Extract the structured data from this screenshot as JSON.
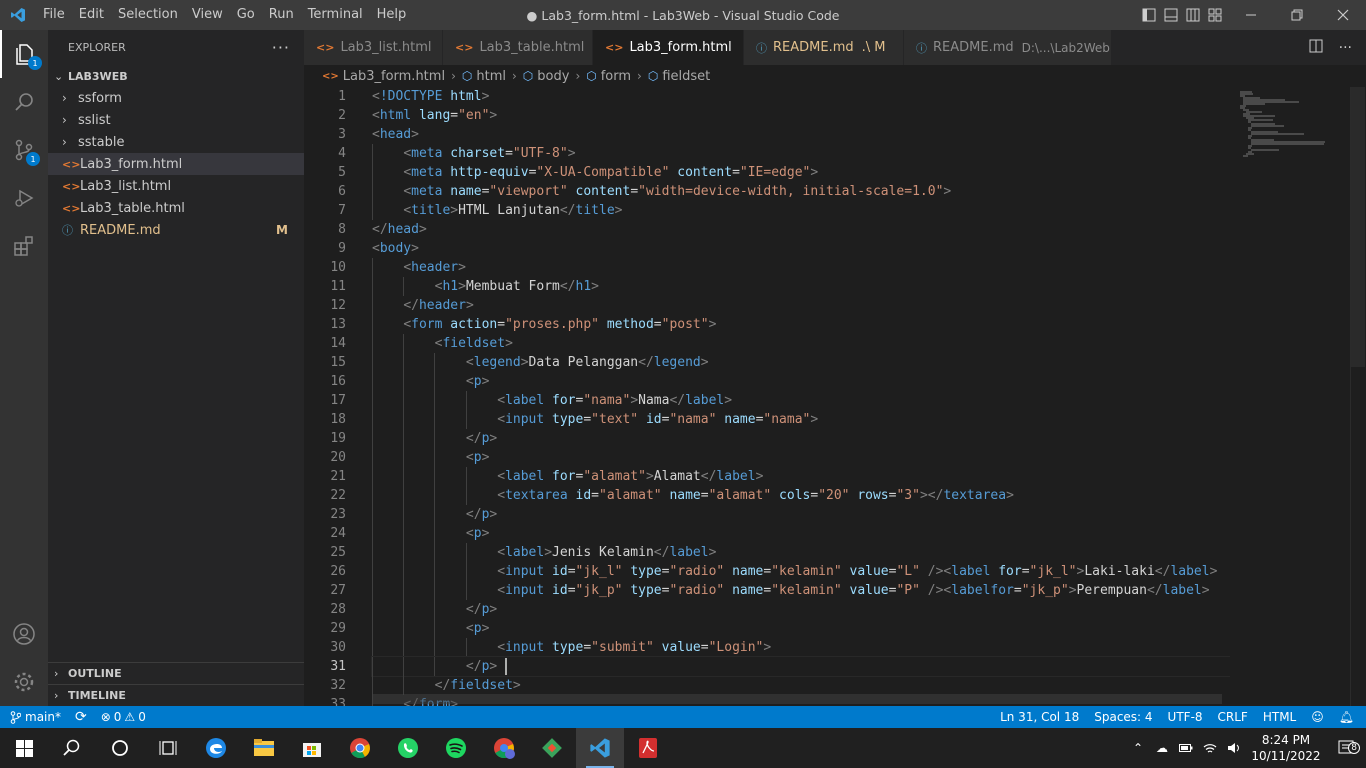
{
  "titlebar": {
    "menu": [
      "File",
      "Edit",
      "Selection",
      "View",
      "Go",
      "Run",
      "Terminal",
      "Help"
    ],
    "window_title": "● Lab3_form.html - Lab3Web - Visual Studio Code"
  },
  "activity": {
    "explorer_badge": "1",
    "scm_badge": "1"
  },
  "explorer": {
    "title": "EXPLORER",
    "more": "···",
    "project": "LAB3WEB",
    "folders": [
      "ssform",
      "sslist",
      "sstable"
    ],
    "files": [
      {
        "name": "Lab3_form.html",
        "icon": "<>",
        "selected": true
      },
      {
        "name": "Lab3_list.html",
        "icon": "<>"
      },
      {
        "name": "Lab3_table.html",
        "icon": "<>"
      },
      {
        "name": "README.md",
        "icon": "ⓘ",
        "status": "M"
      }
    ],
    "outline": "OUTLINE",
    "timeline": "TIMELINE"
  },
  "tabs": [
    {
      "label": "Lab3_list.html",
      "icon": "<>"
    },
    {
      "label": "Lab3_table.html",
      "icon": "<>"
    },
    {
      "label": "Lab3_form.html",
      "icon": "<>",
      "active": true,
      "dirty": true
    },
    {
      "label": "README.md",
      "icon": "ⓘ",
      "suffix": ".\\ M"
    },
    {
      "label": "README.md",
      "icon": "ⓘ",
      "desc": "D:\\...\\Lab2Web"
    }
  ],
  "breadcrumb": [
    "Lab3_form.html",
    "html",
    "body",
    "form",
    "fieldset"
  ],
  "code": {
    "current_line": 31,
    "lines": [
      [
        [
          "br",
          "<"
        ],
        [
          "tag",
          "!DOCTYPE"
        ],
        [
          "tx",
          " "
        ],
        [
          "at",
          "html"
        ],
        [
          "br",
          ">"
        ]
      ],
      [
        [
          "br",
          "<"
        ],
        [
          "tag",
          "html"
        ],
        [
          "tx",
          " "
        ],
        [
          "at",
          "lang"
        ],
        [
          "tx",
          "="
        ],
        [
          "st",
          "\"en\""
        ],
        [
          "br",
          ">"
        ]
      ],
      [
        [
          "br",
          "<"
        ],
        [
          "tag",
          "head"
        ],
        [
          "br",
          ">"
        ]
      ],
      [
        [
          "tx",
          "    "
        ],
        [
          "br",
          "<"
        ],
        [
          "tag",
          "meta"
        ],
        [
          "tx",
          " "
        ],
        [
          "at",
          "charset"
        ],
        [
          "tx",
          "="
        ],
        [
          "st",
          "\"UTF-8\""
        ],
        [
          "br",
          ">"
        ]
      ],
      [
        [
          "tx",
          "    "
        ],
        [
          "br",
          "<"
        ],
        [
          "tag",
          "meta"
        ],
        [
          "tx",
          " "
        ],
        [
          "at",
          "http-equiv"
        ],
        [
          "tx",
          "="
        ],
        [
          "st",
          "\"X-UA-Compatible\""
        ],
        [
          "tx",
          " "
        ],
        [
          "at",
          "content"
        ],
        [
          "tx",
          "="
        ],
        [
          "st",
          "\"IE=edge\""
        ],
        [
          "br",
          ">"
        ]
      ],
      [
        [
          "tx",
          "    "
        ],
        [
          "br",
          "<"
        ],
        [
          "tag",
          "meta"
        ],
        [
          "tx",
          " "
        ],
        [
          "at",
          "name"
        ],
        [
          "tx",
          "="
        ],
        [
          "st",
          "\"viewport\""
        ],
        [
          "tx",
          " "
        ],
        [
          "at",
          "content"
        ],
        [
          "tx",
          "="
        ],
        [
          "st",
          "\"width=device-width, initial-scale=1.0\""
        ],
        [
          "br",
          ">"
        ]
      ],
      [
        [
          "tx",
          "    "
        ],
        [
          "br",
          "<"
        ],
        [
          "tag",
          "title"
        ],
        [
          "br",
          ">"
        ],
        [
          "tx",
          "HTML Lanjutan"
        ],
        [
          "br",
          "</"
        ],
        [
          "tag",
          "title"
        ],
        [
          "br",
          ">"
        ]
      ],
      [
        [
          "br",
          "</"
        ],
        [
          "tag",
          "head"
        ],
        [
          "br",
          ">"
        ]
      ],
      [
        [
          "br",
          "<"
        ],
        [
          "tag",
          "body"
        ],
        [
          "br",
          ">"
        ]
      ],
      [
        [
          "tx",
          "    "
        ],
        [
          "br",
          "<"
        ],
        [
          "tag",
          "header"
        ],
        [
          "br",
          ">"
        ]
      ],
      [
        [
          "tx",
          "        "
        ],
        [
          "br",
          "<"
        ],
        [
          "tag",
          "h1"
        ],
        [
          "br",
          ">"
        ],
        [
          "tx",
          "Membuat Form"
        ],
        [
          "br",
          "</"
        ],
        [
          "tag",
          "h1"
        ],
        [
          "br",
          ">"
        ]
      ],
      [
        [
          "tx",
          "    "
        ],
        [
          "br",
          "</"
        ],
        [
          "tag",
          "header"
        ],
        [
          "br",
          ">"
        ]
      ],
      [
        [
          "tx",
          "    "
        ],
        [
          "br",
          "<"
        ],
        [
          "tag",
          "form"
        ],
        [
          "tx",
          " "
        ],
        [
          "at",
          "action"
        ],
        [
          "tx",
          "="
        ],
        [
          "st",
          "\"proses.php\""
        ],
        [
          "tx",
          " "
        ],
        [
          "at",
          "method"
        ],
        [
          "tx",
          "="
        ],
        [
          "st",
          "\"post\""
        ],
        [
          "br",
          ">"
        ]
      ],
      [
        [
          "tx",
          "        "
        ],
        [
          "br",
          "<"
        ],
        [
          "tag",
          "fieldset"
        ],
        [
          "br",
          ">"
        ]
      ],
      [
        [
          "tx",
          "            "
        ],
        [
          "br",
          "<"
        ],
        [
          "tag",
          "legend"
        ],
        [
          "br",
          ">"
        ],
        [
          "tx",
          "Data Pelanggan"
        ],
        [
          "br",
          "</"
        ],
        [
          "tag",
          "legend"
        ],
        [
          "br",
          ">"
        ]
      ],
      [
        [
          "tx",
          "            "
        ],
        [
          "br",
          "<"
        ],
        [
          "tag",
          "p"
        ],
        [
          "br",
          ">"
        ]
      ],
      [
        [
          "tx",
          "                "
        ],
        [
          "br",
          "<"
        ],
        [
          "tag",
          "label"
        ],
        [
          "tx",
          " "
        ],
        [
          "at",
          "for"
        ],
        [
          "tx",
          "="
        ],
        [
          "st",
          "\"nama\""
        ],
        [
          "br",
          ">"
        ],
        [
          "tx",
          "Nama"
        ],
        [
          "br",
          "</"
        ],
        [
          "tag",
          "label"
        ],
        [
          "br",
          ">"
        ]
      ],
      [
        [
          "tx",
          "                "
        ],
        [
          "br",
          "<"
        ],
        [
          "tag",
          "input"
        ],
        [
          "tx",
          " "
        ],
        [
          "at",
          "type"
        ],
        [
          "tx",
          "="
        ],
        [
          "st",
          "\"text\""
        ],
        [
          "tx",
          " "
        ],
        [
          "at",
          "id"
        ],
        [
          "tx",
          "="
        ],
        [
          "st",
          "\"nama\""
        ],
        [
          "tx",
          " "
        ],
        [
          "at",
          "name"
        ],
        [
          "tx",
          "="
        ],
        [
          "st",
          "\"nama\""
        ],
        [
          "br",
          ">"
        ]
      ],
      [
        [
          "tx",
          "            "
        ],
        [
          "br",
          "</"
        ],
        [
          "tag",
          "p"
        ],
        [
          "br",
          ">"
        ]
      ],
      [
        [
          "tx",
          "            "
        ],
        [
          "br",
          "<"
        ],
        [
          "tag",
          "p"
        ],
        [
          "br",
          ">"
        ]
      ],
      [
        [
          "tx",
          "                "
        ],
        [
          "br",
          "<"
        ],
        [
          "tag",
          "label"
        ],
        [
          "tx",
          " "
        ],
        [
          "at",
          "for"
        ],
        [
          "tx",
          "="
        ],
        [
          "st",
          "\"alamat\""
        ],
        [
          "br",
          ">"
        ],
        [
          "tx",
          "Alamat"
        ],
        [
          "br",
          "</"
        ],
        [
          "tag",
          "label"
        ],
        [
          "br",
          ">"
        ]
      ],
      [
        [
          "tx",
          "                "
        ],
        [
          "br",
          "<"
        ],
        [
          "tag",
          "textarea"
        ],
        [
          "tx",
          " "
        ],
        [
          "at",
          "id"
        ],
        [
          "tx",
          "="
        ],
        [
          "st",
          "\"alamat\""
        ],
        [
          "tx",
          " "
        ],
        [
          "at",
          "name"
        ],
        [
          "tx",
          "="
        ],
        [
          "st",
          "\"alamat\""
        ],
        [
          "tx",
          " "
        ],
        [
          "at",
          "cols"
        ],
        [
          "tx",
          "="
        ],
        [
          "st",
          "\"20\""
        ],
        [
          "tx",
          " "
        ],
        [
          "at",
          "rows"
        ],
        [
          "tx",
          "="
        ],
        [
          "st",
          "\"3\""
        ],
        [
          "br",
          "></"
        ],
        [
          "tag",
          "textarea"
        ],
        [
          "br",
          ">"
        ]
      ],
      [
        [
          "tx",
          "            "
        ],
        [
          "br",
          "</"
        ],
        [
          "tag",
          "p"
        ],
        [
          "br",
          ">"
        ]
      ],
      [
        [
          "tx",
          "            "
        ],
        [
          "br",
          "<"
        ],
        [
          "tag",
          "p"
        ],
        [
          "br",
          ">"
        ]
      ],
      [
        [
          "tx",
          "                "
        ],
        [
          "br",
          "<"
        ],
        [
          "tag",
          "label"
        ],
        [
          "br",
          ">"
        ],
        [
          "tx",
          "Jenis Kelamin"
        ],
        [
          "br",
          "</"
        ],
        [
          "tag",
          "label"
        ],
        [
          "br",
          ">"
        ]
      ],
      [
        [
          "tx",
          "                "
        ],
        [
          "br",
          "<"
        ],
        [
          "tag",
          "input"
        ],
        [
          "tx",
          " "
        ],
        [
          "at",
          "id"
        ],
        [
          "tx",
          "="
        ],
        [
          "st",
          "\"jk_l\""
        ],
        [
          "tx",
          " "
        ],
        [
          "at",
          "type"
        ],
        [
          "tx",
          "="
        ],
        [
          "st",
          "\"radio\""
        ],
        [
          "tx",
          " "
        ],
        [
          "at",
          "name"
        ],
        [
          "tx",
          "="
        ],
        [
          "st",
          "\"kelamin\""
        ],
        [
          "tx",
          " "
        ],
        [
          "at",
          "value"
        ],
        [
          "tx",
          "="
        ],
        [
          "st",
          "\"L\""
        ],
        [
          "tx",
          " "
        ],
        [
          "br",
          "/><"
        ],
        [
          "tag",
          "label"
        ],
        [
          "tx",
          " "
        ],
        [
          "at",
          "for"
        ],
        [
          "tx",
          "="
        ],
        [
          "st",
          "\"jk_l\""
        ],
        [
          "br",
          ">"
        ],
        [
          "tx",
          "Laki-laki"
        ],
        [
          "br",
          "</"
        ],
        [
          "tag",
          "label"
        ],
        [
          "br",
          ">"
        ]
      ],
      [
        [
          "tx",
          "                "
        ],
        [
          "br",
          "<"
        ],
        [
          "tag",
          "input"
        ],
        [
          "tx",
          " "
        ],
        [
          "at",
          "id"
        ],
        [
          "tx",
          "="
        ],
        [
          "st",
          "\"jk_p\""
        ],
        [
          "tx",
          " "
        ],
        [
          "at",
          "type"
        ],
        [
          "tx",
          "="
        ],
        [
          "st",
          "\"radio\""
        ],
        [
          "tx",
          " "
        ],
        [
          "at",
          "name"
        ],
        [
          "tx",
          "="
        ],
        [
          "st",
          "\"kelamin\""
        ],
        [
          "tx",
          " "
        ],
        [
          "at",
          "value"
        ],
        [
          "tx",
          "="
        ],
        [
          "st",
          "\"P\""
        ],
        [
          "tx",
          " "
        ],
        [
          "br",
          "/><"
        ],
        [
          "tag",
          "labelfor"
        ],
        [
          "tx",
          "="
        ],
        [
          "st",
          "\"jk_p\""
        ],
        [
          "br",
          ">"
        ],
        [
          "tx",
          "Perempuan"
        ],
        [
          "br",
          "</"
        ],
        [
          "tag",
          "label"
        ],
        [
          "br",
          ">"
        ]
      ],
      [
        [
          "tx",
          "            "
        ],
        [
          "br",
          "</"
        ],
        [
          "tag",
          "p"
        ],
        [
          "br",
          ">"
        ]
      ],
      [
        [
          "tx",
          "            "
        ],
        [
          "br",
          "<"
        ],
        [
          "tag",
          "p"
        ],
        [
          "br",
          ">"
        ]
      ],
      [
        [
          "tx",
          "                "
        ],
        [
          "br",
          "<"
        ],
        [
          "tag",
          "input"
        ],
        [
          "tx",
          " "
        ],
        [
          "at",
          "type"
        ],
        [
          "tx",
          "="
        ],
        [
          "st",
          "\"submit\""
        ],
        [
          "tx",
          " "
        ],
        [
          "at",
          "value"
        ],
        [
          "tx",
          "="
        ],
        [
          "st",
          "\"Login\""
        ],
        [
          "br",
          ">"
        ]
      ],
      [
        [
          "tx",
          "            "
        ],
        [
          "br",
          "</"
        ],
        [
          "tag",
          "p"
        ],
        [
          "br",
          ">"
        ]
      ],
      [
        [
          "tx",
          "        "
        ],
        [
          "br",
          "</"
        ],
        [
          "tag",
          "fieldset"
        ],
        [
          "br",
          ">"
        ]
      ],
      [
        [
          "tx",
          "    "
        ],
        [
          "br",
          "</"
        ],
        [
          "tag",
          "form"
        ],
        [
          "br",
          ">"
        ]
      ]
    ]
  },
  "status": {
    "branch": "main*",
    "errors": "0",
    "warnings": "0",
    "position": "Ln 31, Col 18",
    "spaces": "Spaces: 4",
    "encoding": "UTF-8",
    "eol": "CRLF",
    "language": "HTML"
  },
  "taskbar": {
    "time": "8:24 PM",
    "date": "10/11/2022",
    "notifications": "8"
  },
  "colors": {
    "accent": "#007acc",
    "tag": "#569cd6",
    "attribute": "#9cdcfe",
    "string": "#ce9178"
  }
}
